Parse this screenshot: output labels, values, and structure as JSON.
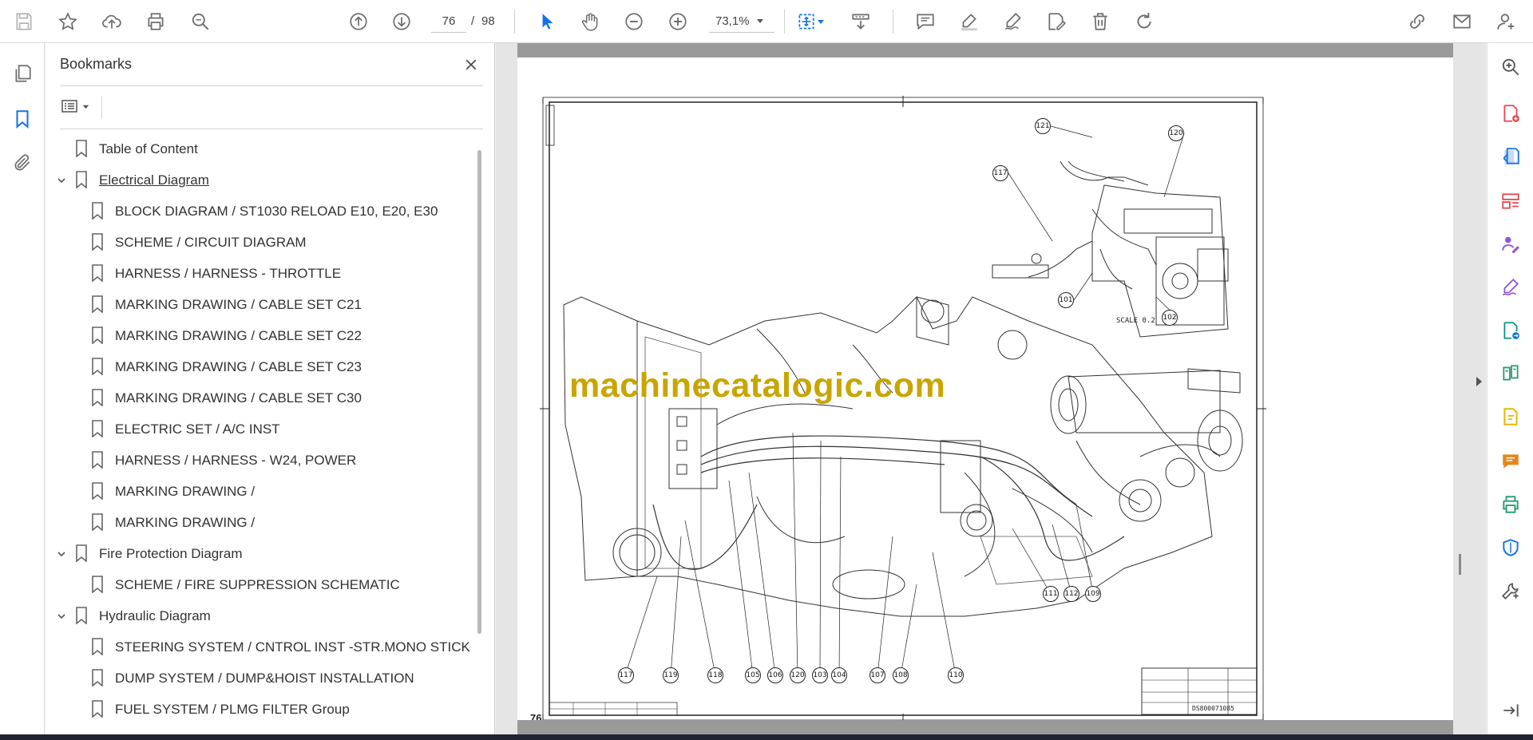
{
  "toolbar": {
    "page_current": "76",
    "page_separator": "/",
    "page_total": "98",
    "zoom_level": "73,1%"
  },
  "bookmarks": {
    "title": "Bookmarks",
    "items": [
      {
        "label": "Table of Content",
        "level": 0,
        "expandable": false
      },
      {
        "label": "Electrical Diagram",
        "level": 0,
        "expandable": true,
        "underline": true
      },
      {
        "label": "BLOCK DIAGRAM / ST1030 RELOAD E10, E20, E30",
        "level": 1
      },
      {
        "label": "SCHEME / CIRCUIT DIAGRAM",
        "level": 1
      },
      {
        "label": "HARNESS / HARNESS - THROTTLE",
        "level": 1
      },
      {
        "label": "MARKING DRAWING / CABLE SET C21",
        "level": 1
      },
      {
        "label": "MARKING DRAWING / CABLE SET C22",
        "level": 1
      },
      {
        "label": "MARKING DRAWING / CABLE SET C23",
        "level": 1
      },
      {
        "label": "MARKING DRAWING / CABLE SET C30",
        "level": 1
      },
      {
        "label": "ELECTRIC SET / A/C INST",
        "level": 1
      },
      {
        "label": "HARNESS / HARNESS - W24, POWER",
        "level": 1
      },
      {
        "label": "MARKING DRAWING /",
        "level": 1
      },
      {
        "label": "MARKING DRAWING /",
        "level": 1
      },
      {
        "label": "Fire Protection Diagram",
        "level": 0,
        "expandable": true
      },
      {
        "label": "SCHEME / FIRE SUPPRESSION SCHEMATIC",
        "level": 1
      },
      {
        "label": "Hydraulic Diagram",
        "level": 0,
        "expandable": true
      },
      {
        "label": "STEERING SYSTEM / CNTROL INST -STR.MONO STICK",
        "level": 1
      },
      {
        "label": "DUMP SYSTEM / DUMP&HOIST INSTALLATION",
        "level": 1
      },
      {
        "label": "FUEL SYSTEM / PLMG FILTER Group",
        "level": 1
      }
    ]
  },
  "document": {
    "page_number": "76",
    "watermark": "machinecatalogic.com",
    "scale_label": "SCALE  0.2",
    "drawing_number": "DS800071085",
    "balloons_main": [
      "117",
      "119",
      "118",
      "105",
      "106",
      "120",
      "103",
      "104",
      "107",
      "108",
      "110",
      "111",
      "112",
      "109"
    ],
    "balloons_detail": [
      "121",
      "120",
      "117",
      "101",
      "102"
    ]
  },
  "colors": {
    "accent_blue": "#1473e6",
    "icon_gray": "#6e6e6e",
    "watermark": "#c9a500",
    "red": "#e34850",
    "purple": "#9256d9",
    "green": "#2d9d78",
    "orange": "#e68619",
    "yellow": "#e6b800",
    "teal": "#0d9488"
  }
}
